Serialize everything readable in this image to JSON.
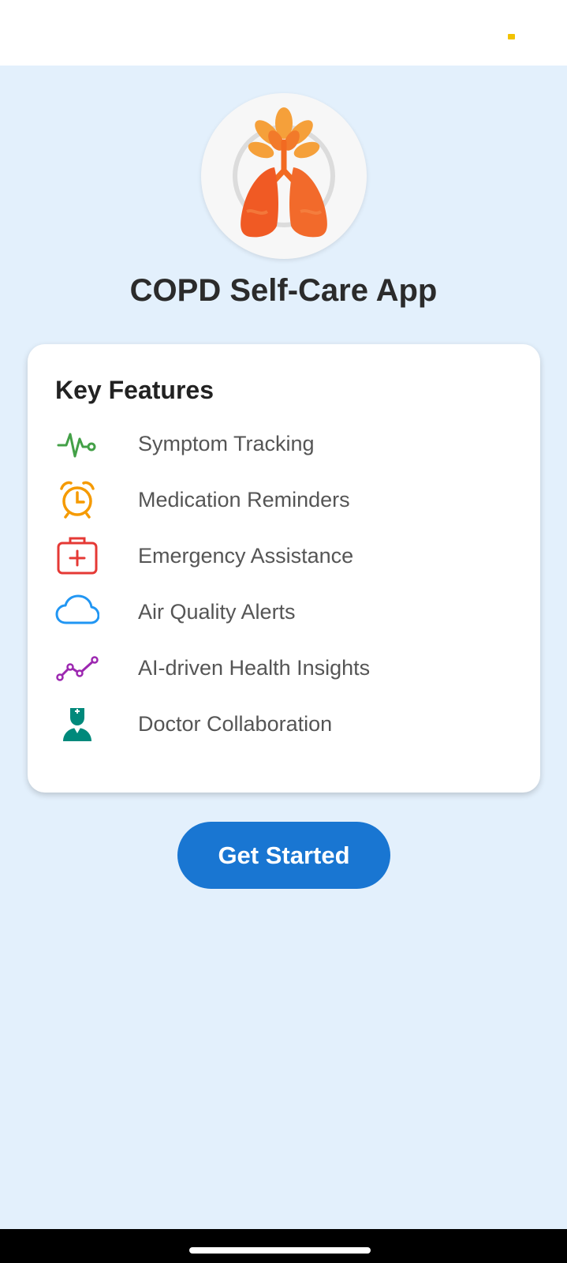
{
  "app": {
    "title": "COPD Self-Care App"
  },
  "features_card": {
    "heading": "Key Features",
    "items": [
      {
        "label": "Symptom Tracking",
        "icon": "heartbeat-icon",
        "color": "#43a047"
      },
      {
        "label": "Medication Reminders",
        "icon": "alarm-clock-icon",
        "color": "#f59a00"
      },
      {
        "label": "Emergency Assistance",
        "icon": "medical-kit-icon",
        "color": "#e53935"
      },
      {
        "label": "Air Quality Alerts",
        "icon": "cloud-icon",
        "color": "#2196f3"
      },
      {
        "label": "AI-driven Health Insights",
        "icon": "trend-line-icon",
        "color": "#9c27b0"
      },
      {
        "label": "Doctor Collaboration",
        "icon": "doctor-icon",
        "color": "#00897b"
      }
    ]
  },
  "actions": {
    "get_started_label": "Get Started"
  },
  "colors": {
    "background": "#e3f0fc",
    "primary": "#1976d2",
    "logo_orange": "#f26a21"
  }
}
